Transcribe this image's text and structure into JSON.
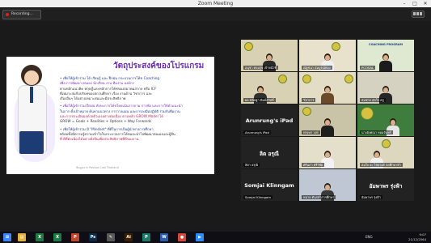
{
  "window": {
    "title": "Zoom Meeting",
    "minimize": "–",
    "maximize": "□",
    "close": "✕"
  },
  "recording": {
    "label": "Recording..."
  },
  "slide": {
    "title": "วัตถุประสงค์ของโปรแกรม",
    "bullets": [
      {
        "lines": [
          "• เพื่อให้ผู้เข้าร่วม ได้ เรียนรู้ และ ฝึกฝน กระบวนการโค้ช Coaching",
          "เพื่อ การพัฒนา ตนเอง นักเรียน งาน ทีมงาน องค์กร",
          "ตามหลักแนวคิด ทฤษฎีและหลักการโค้ชของสมาคมสากล หรือ ICF",
          "ที่เหมาะสมกับบริบทของสถานศึกษา เรื่อง งานด้าน วิชาการ และ",
          "เรื่องอื่นๆ ได้อย่างเหมาะสมและมีประสิทธิภาพ"
        ]
      },
      {
        "lines": [
          "• เพื่อให้ผู้เข้าร่วม ฝึกฝน ทักษะการโค้ชโดยเน้นการถาม การฟัง และการให้คำแนะนำ",
          "ในการ ตั้งเป้าหมาย ค้นหาแนวทาง การวางแผน และการลงมือปฏิบัติ ร่วมกับทีมงาน",
          "และการประเมินผลด้วยตัวเองอย่างต่อเนื่อง ตามหลัก GROW Model ได้",
          "GROW = Goals + Realities + Options + Way Forwards"
        ]
      },
      {
        "lines": [
          "• เพื่อให้ผู้เข้าร่วม มี \"Mindset\" ที่ดีในการเป็นผู้นำทางการศึกษา",
          "พร้อมทั้งมีความรู้ความเข้าใจในกระบวนการโค้ชและนำไปพัฒนาตนเองและผู้อื่น",
          "ที่ ดีที่ต่อเนื่องได้อย่างยั่งยืนเพื่อประสิทธิภาพที่ดีของงาน"
        ]
      }
    ],
    "credit": "ข้อมูลจาก Passion Lab Thailand"
  },
  "participants": [
    {
      "name": "อนุชา ทองสุข เจ้าหน้าที่",
      "kind": "video"
    },
    {
      "name": "ณัฐชนา สมบูรณ์ทอง",
      "kind": "video"
    },
    {
      "name": "PCOSAL",
      "kind": "video",
      "banner": "COACHING PROGRAM"
    },
    {
      "name": "ผอ.ขนิษฐา พิมพ์สวัสดิ์",
      "kind": "video"
    },
    {
      "name": "วิชาการ",
      "kind": "video"
    },
    {
      "name": "สมชาย สุขใจ ครู",
      "kind": "video"
    },
    {
      "name": "Arunrung's iPad",
      "kind": "text",
      "big": "Arunrung's iPad"
    },
    {
      "name": "ทรงพร วงษ์",
      "kind": "video"
    },
    {
      "name": "นางอังคณา หอมจันทร์",
      "kind": "video"
    },
    {
      "name": "ลิตา อรุณี",
      "kind": "text",
      "big": "ลิต อรุณี"
    },
    {
      "name": "ศรีนภา ศรีวิชัย",
      "kind": "video"
    },
    {
      "name": "สมใจ ยะ ไชยวงค์ นักศึกษาทำ",
      "kind": "video"
    },
    {
      "name": "Somjai Klinngam",
      "kind": "text",
      "big": "Somjai Klinngam"
    },
    {
      "name": "หน่วย ต้นกล้าการศึกษา",
      "kind": "video"
    },
    {
      "name": "อัมพาพร รุ่งฟ้า",
      "kind": "text",
      "big": "อัมพาพร รุ่งฟ้า"
    }
  ],
  "taskbar": {
    "apps": [
      {
        "name": "windows-start",
        "label": "⊞",
        "color": "#3a86ff"
      },
      {
        "name": "file-explorer",
        "label": "▤",
        "color": "#e3b341"
      },
      {
        "name": "excel",
        "label": "X",
        "color": "#1f7a43"
      },
      {
        "name": "excel-2",
        "label": "X",
        "color": "#1f7a43"
      },
      {
        "name": "powerpoint",
        "label": "P",
        "color": "#c4472c"
      },
      {
        "name": "photoshop",
        "label": "Ps",
        "color": "#0a2a4a"
      },
      {
        "name": "paint",
        "label": "✎",
        "color": "#5a5a5a"
      },
      {
        "name": "illustrator",
        "label": "Ai",
        "color": "#3b1f00"
      },
      {
        "name": "publisher",
        "label": "P",
        "color": "#1d7a6a"
      },
      {
        "name": "word",
        "label": "W",
        "color": "#2a5caa"
      },
      {
        "name": "chrome",
        "label": "●",
        "color": "#d6473a"
      },
      {
        "name": "zoom",
        "label": "▶",
        "color": "#2d8cff"
      }
    ],
    "lang": "ENG",
    "time": "9:07",
    "date": "21/12/2564"
  }
}
